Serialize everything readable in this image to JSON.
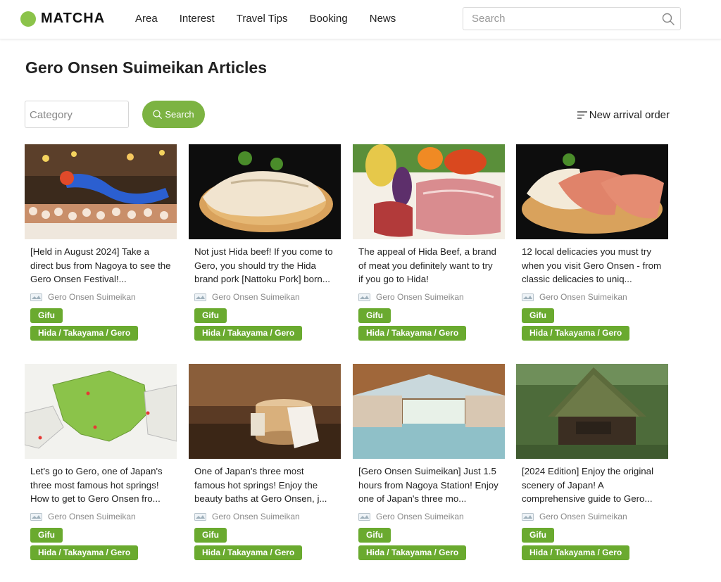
{
  "colors": {
    "accent": "#7cb342",
    "tag": "#6aaa2f",
    "logo_dot": "#8bc34a"
  },
  "header": {
    "logo_text": "MATCHA",
    "nav": [
      "Area",
      "Interest",
      "Travel Tips",
      "Booking",
      "News"
    ],
    "search_placeholder": "Search"
  },
  "page": {
    "title": "Gero Onsen Suimeikan Articles",
    "category_placeholder": "Category",
    "search_button": "Search",
    "sort_label": "New arrival order"
  },
  "articles": [
    {
      "title": "[Held in August 2024] Take a direct bus from Nagoya to see the Gero Onsen Festival!...",
      "author": "Gero Onsen Suimeikan",
      "tags": [
        "Gifu",
        "Hida / Takayama / Gero"
      ],
      "image": "festival-dragon"
    },
    {
      "title": "Not just Hida beef! If you come to Gero, you should try the Hida brand pork [Nattoku Pork] born...",
      "author": "Gero Onsen Suimeikan",
      "tags": [
        "Gifu",
        "Hida / Takayama / Gero"
      ],
      "image": "pork-sushi"
    },
    {
      "title": "The appeal of Hida Beef, a brand of meat you definitely want to try if you go to Hida!",
      "author": "Gero Onsen Suimeikan",
      "tags": [
        "Gifu",
        "Hida / Takayama / Gero"
      ],
      "image": "beef-vegetables"
    },
    {
      "title": "12 local delicacies you must try when you visit Gero Onsen - from classic delicacies to uniq...",
      "author": "Gero Onsen Suimeikan",
      "tags": [
        "Gifu",
        "Hida / Takayama / Gero"
      ],
      "image": "beef-sushi"
    },
    {
      "title": "Let's go to Gero, one of Japan's three most famous hot springs! How to get to Gero Onsen fro...",
      "author": "Gero Onsen Suimeikan",
      "tags": [
        "Gifu",
        "Hida / Takayama / Gero"
      ],
      "image": "map"
    },
    {
      "title": "One of Japan's three most famous hot springs! Enjoy the beauty baths at Gero Onsen, j...",
      "author": "Gero Onsen Suimeikan",
      "tags": [
        "Gifu",
        "Hida / Takayama / Gero"
      ],
      "image": "onsen-bucket"
    },
    {
      "title": "[Gero Onsen Suimeikan] Just 1.5 hours from Nagoya Station! Enjoy one of Japan's three mo...",
      "author": "Gero Onsen Suimeikan",
      "tags": [
        "Gifu",
        "Hida / Takayama / Gero"
      ],
      "image": "indoor-bath"
    },
    {
      "title": "[2024 Edition] Enjoy the original scenery of Japan! A comprehensive guide to Gero...",
      "author": "Gero Onsen Suimeikan",
      "tags": [
        "Gifu",
        "Hida / Takayama / Gero"
      ],
      "image": "gassho-house"
    }
  ]
}
